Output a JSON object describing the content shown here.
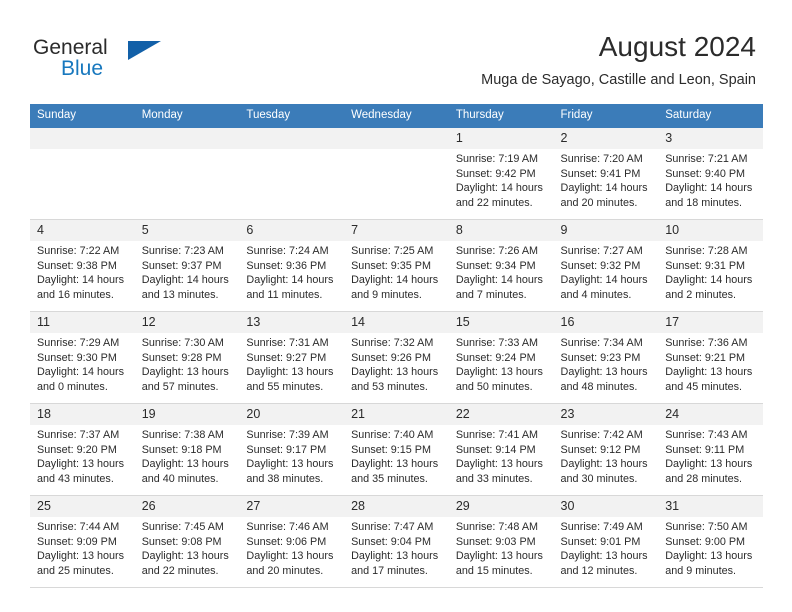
{
  "brand": {
    "name_part1": "General",
    "name_part2": "Blue",
    "triangle_color": "#1260a8",
    "blue_color": "#1878be"
  },
  "header": {
    "month_title": "August 2024",
    "location": "Muga de Sayago, Castille and Leon, Spain"
  },
  "calendar": {
    "header_bg": "#3b7cb9",
    "weekdays": [
      "Sunday",
      "Monday",
      "Tuesday",
      "Wednesday",
      "Thursday",
      "Friday",
      "Saturday"
    ],
    "leading_blanks": 4,
    "days": [
      {
        "day": "1",
        "sunrise": "Sunrise: 7:19 AM",
        "sunset": "Sunset: 9:42 PM",
        "daylight1": "Daylight: 14 hours",
        "daylight2": "and 22 minutes."
      },
      {
        "day": "2",
        "sunrise": "Sunrise: 7:20 AM",
        "sunset": "Sunset: 9:41 PM",
        "daylight1": "Daylight: 14 hours",
        "daylight2": "and 20 minutes."
      },
      {
        "day": "3",
        "sunrise": "Sunrise: 7:21 AM",
        "sunset": "Sunset: 9:40 PM",
        "daylight1": "Daylight: 14 hours",
        "daylight2": "and 18 minutes."
      },
      {
        "day": "4",
        "sunrise": "Sunrise: 7:22 AM",
        "sunset": "Sunset: 9:38 PM",
        "daylight1": "Daylight: 14 hours",
        "daylight2": "and 16 minutes."
      },
      {
        "day": "5",
        "sunrise": "Sunrise: 7:23 AM",
        "sunset": "Sunset: 9:37 PM",
        "daylight1": "Daylight: 14 hours",
        "daylight2": "and 13 minutes."
      },
      {
        "day": "6",
        "sunrise": "Sunrise: 7:24 AM",
        "sunset": "Sunset: 9:36 PM",
        "daylight1": "Daylight: 14 hours",
        "daylight2": "and 11 minutes."
      },
      {
        "day": "7",
        "sunrise": "Sunrise: 7:25 AM",
        "sunset": "Sunset: 9:35 PM",
        "daylight1": "Daylight: 14 hours",
        "daylight2": "and 9 minutes."
      },
      {
        "day": "8",
        "sunrise": "Sunrise: 7:26 AM",
        "sunset": "Sunset: 9:34 PM",
        "daylight1": "Daylight: 14 hours",
        "daylight2": "and 7 minutes."
      },
      {
        "day": "9",
        "sunrise": "Sunrise: 7:27 AM",
        "sunset": "Sunset: 9:32 PM",
        "daylight1": "Daylight: 14 hours",
        "daylight2": "and 4 minutes."
      },
      {
        "day": "10",
        "sunrise": "Sunrise: 7:28 AM",
        "sunset": "Sunset: 9:31 PM",
        "daylight1": "Daylight: 14 hours",
        "daylight2": "and 2 minutes."
      },
      {
        "day": "11",
        "sunrise": "Sunrise: 7:29 AM",
        "sunset": "Sunset: 9:30 PM",
        "daylight1": "Daylight: 14 hours",
        "daylight2": "and 0 minutes."
      },
      {
        "day": "12",
        "sunrise": "Sunrise: 7:30 AM",
        "sunset": "Sunset: 9:28 PM",
        "daylight1": "Daylight: 13 hours",
        "daylight2": "and 57 minutes."
      },
      {
        "day": "13",
        "sunrise": "Sunrise: 7:31 AM",
        "sunset": "Sunset: 9:27 PM",
        "daylight1": "Daylight: 13 hours",
        "daylight2": "and 55 minutes."
      },
      {
        "day": "14",
        "sunrise": "Sunrise: 7:32 AM",
        "sunset": "Sunset: 9:26 PM",
        "daylight1": "Daylight: 13 hours",
        "daylight2": "and 53 minutes."
      },
      {
        "day": "15",
        "sunrise": "Sunrise: 7:33 AM",
        "sunset": "Sunset: 9:24 PM",
        "daylight1": "Daylight: 13 hours",
        "daylight2": "and 50 minutes."
      },
      {
        "day": "16",
        "sunrise": "Sunrise: 7:34 AM",
        "sunset": "Sunset: 9:23 PM",
        "daylight1": "Daylight: 13 hours",
        "daylight2": "and 48 minutes."
      },
      {
        "day": "17",
        "sunrise": "Sunrise: 7:36 AM",
        "sunset": "Sunset: 9:21 PM",
        "daylight1": "Daylight: 13 hours",
        "daylight2": "and 45 minutes."
      },
      {
        "day": "18",
        "sunrise": "Sunrise: 7:37 AM",
        "sunset": "Sunset: 9:20 PM",
        "daylight1": "Daylight: 13 hours",
        "daylight2": "and 43 minutes."
      },
      {
        "day": "19",
        "sunrise": "Sunrise: 7:38 AM",
        "sunset": "Sunset: 9:18 PM",
        "daylight1": "Daylight: 13 hours",
        "daylight2": "and 40 minutes."
      },
      {
        "day": "20",
        "sunrise": "Sunrise: 7:39 AM",
        "sunset": "Sunset: 9:17 PM",
        "daylight1": "Daylight: 13 hours",
        "daylight2": "and 38 minutes."
      },
      {
        "day": "21",
        "sunrise": "Sunrise: 7:40 AM",
        "sunset": "Sunset: 9:15 PM",
        "daylight1": "Daylight: 13 hours",
        "daylight2": "and 35 minutes."
      },
      {
        "day": "22",
        "sunrise": "Sunrise: 7:41 AM",
        "sunset": "Sunset: 9:14 PM",
        "daylight1": "Daylight: 13 hours",
        "daylight2": "and 33 minutes."
      },
      {
        "day": "23",
        "sunrise": "Sunrise: 7:42 AM",
        "sunset": "Sunset: 9:12 PM",
        "daylight1": "Daylight: 13 hours",
        "daylight2": "and 30 minutes."
      },
      {
        "day": "24",
        "sunrise": "Sunrise: 7:43 AM",
        "sunset": "Sunset: 9:11 PM",
        "daylight1": "Daylight: 13 hours",
        "daylight2": "and 28 minutes."
      },
      {
        "day": "25",
        "sunrise": "Sunrise: 7:44 AM",
        "sunset": "Sunset: 9:09 PM",
        "daylight1": "Daylight: 13 hours",
        "daylight2": "and 25 minutes."
      },
      {
        "day": "26",
        "sunrise": "Sunrise: 7:45 AM",
        "sunset": "Sunset: 9:08 PM",
        "daylight1": "Daylight: 13 hours",
        "daylight2": "and 22 minutes."
      },
      {
        "day": "27",
        "sunrise": "Sunrise: 7:46 AM",
        "sunset": "Sunset: 9:06 PM",
        "daylight1": "Daylight: 13 hours",
        "daylight2": "and 20 minutes."
      },
      {
        "day": "28",
        "sunrise": "Sunrise: 7:47 AM",
        "sunset": "Sunset: 9:04 PM",
        "daylight1": "Daylight: 13 hours",
        "daylight2": "and 17 minutes."
      },
      {
        "day": "29",
        "sunrise": "Sunrise: 7:48 AM",
        "sunset": "Sunset: 9:03 PM",
        "daylight1": "Daylight: 13 hours",
        "daylight2": "and 15 minutes."
      },
      {
        "day": "30",
        "sunrise": "Sunrise: 7:49 AM",
        "sunset": "Sunset: 9:01 PM",
        "daylight1": "Daylight: 13 hours",
        "daylight2": "and 12 minutes."
      },
      {
        "day": "31",
        "sunrise": "Sunrise: 7:50 AM",
        "sunset": "Sunset: 9:00 PM",
        "daylight1": "Daylight: 13 hours",
        "daylight2": "and 9 minutes."
      }
    ]
  }
}
